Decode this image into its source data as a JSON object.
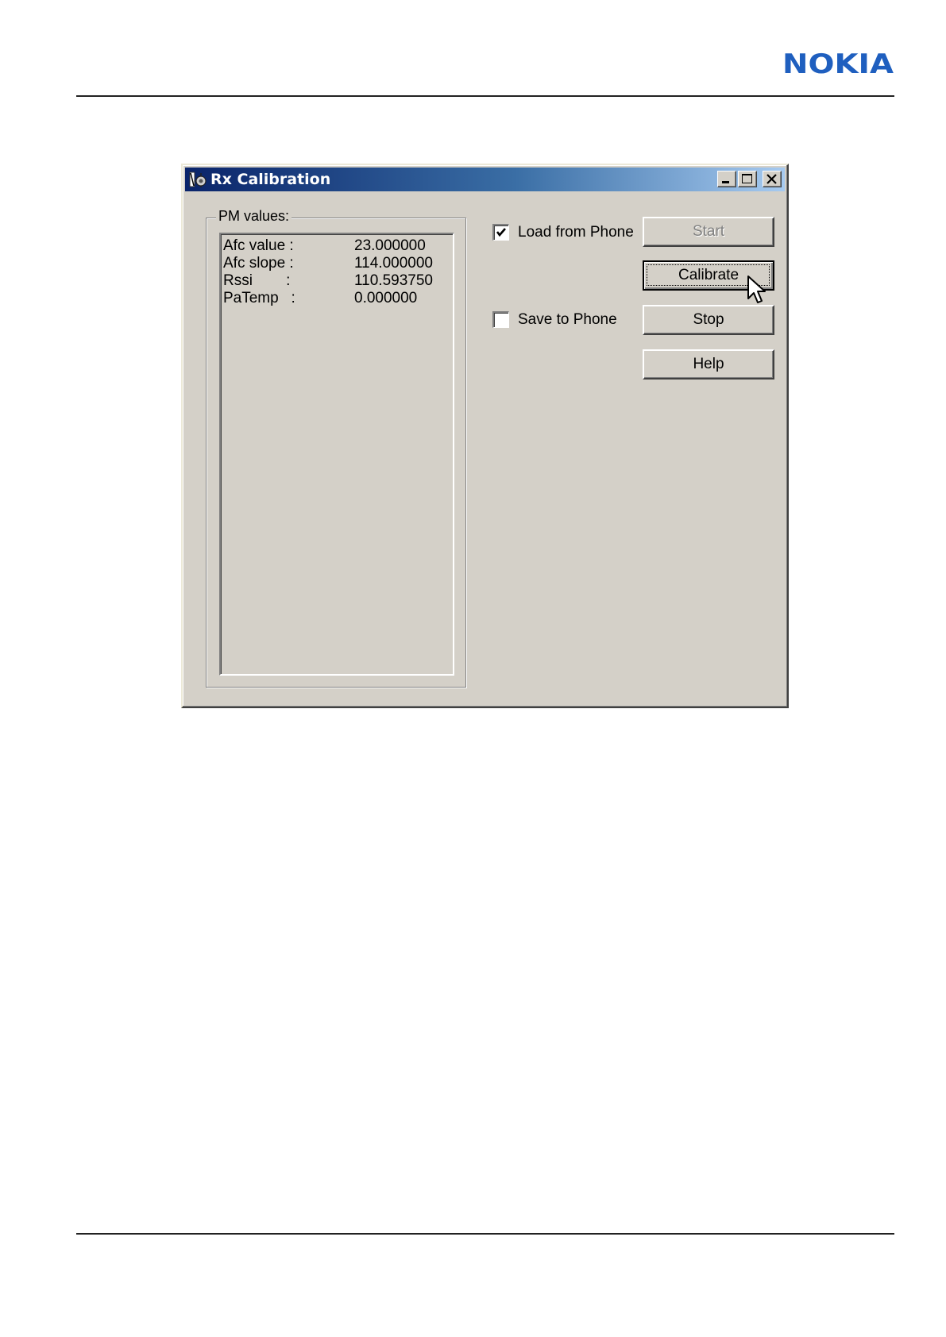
{
  "brand": {
    "logo_text": "NOKIA",
    "logo_color": "#1f5fbf"
  },
  "window": {
    "title": "Rx Calibration",
    "title_icon": "calibration-app-icon",
    "controls": [
      "minimize-icon",
      "maximize-icon",
      "close-icon"
    ]
  },
  "pm_values": {
    "group_label": "PM values:",
    "rows": [
      {
        "label": "Afc value :",
        "value": "23.000000"
      },
      {
        "label": "Afc slope :",
        "value": "114.000000"
      },
      {
        "label": "Rssi        :",
        "value": "110.593750"
      },
      {
        "label": "PaTemp   :",
        "value": "0.000000"
      }
    ]
  },
  "options": {
    "load_from_phone": {
      "label": "Load from Phone",
      "checked": true
    },
    "save_to_phone": {
      "label": "Save to Phone",
      "checked": false
    }
  },
  "buttons": {
    "start": {
      "label": "Start",
      "enabled": false
    },
    "calibrate": {
      "label": "Calibrate",
      "enabled": true,
      "focused": true
    },
    "stop": {
      "label": "Stop",
      "enabled": true
    },
    "help": {
      "label": "Help",
      "enabled": true
    }
  },
  "colors": {
    "dialog_face": "#d4d0c8",
    "titlebar_start": "#0a246a",
    "titlebar_end": "#a6caf0"
  }
}
